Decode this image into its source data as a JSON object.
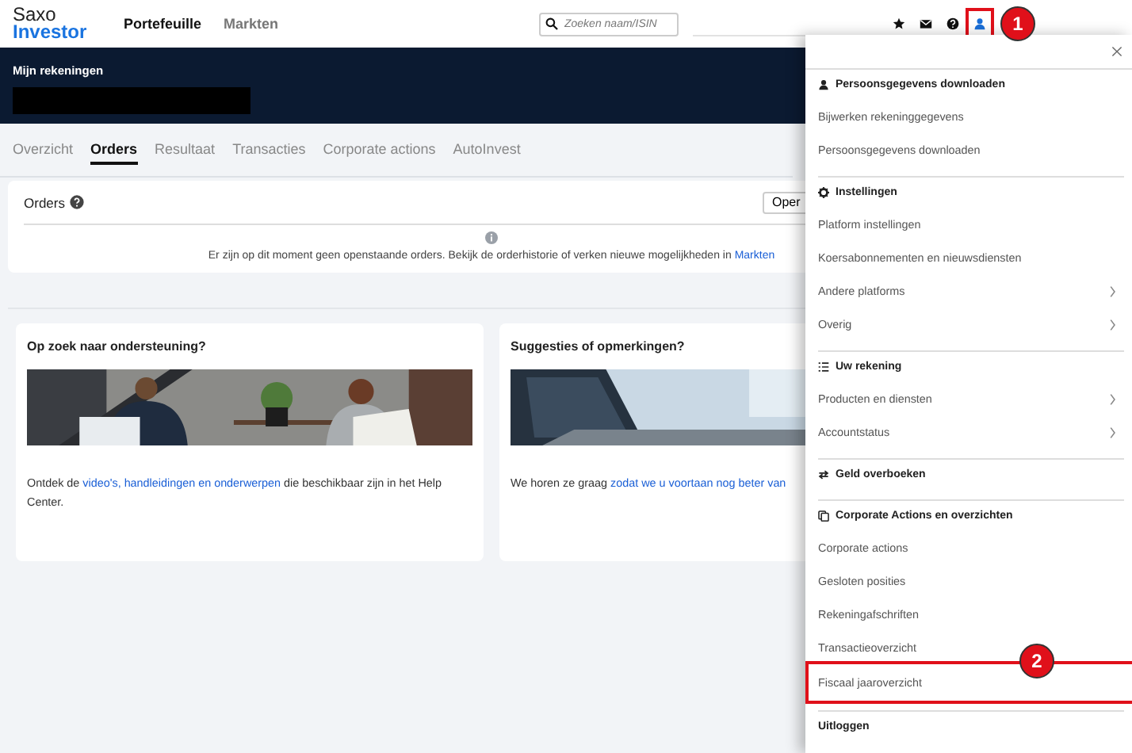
{
  "header": {
    "logo": {
      "line1": "Saxo",
      "line2": "Investor"
    },
    "nav": [
      {
        "label": "Portefeuille",
        "selected": true
      },
      {
        "label": "Markten",
        "selected": false
      }
    ],
    "search": {
      "placeholder": "Zoeken naam/ISIN"
    },
    "toolbar_icons": [
      {
        "kind": "star",
        "annotated": false
      },
      {
        "kind": "mail",
        "annotated": false
      },
      {
        "kind": "help",
        "annotated": false
      },
      {
        "kind": "user",
        "annotated": true,
        "badge": "1"
      }
    ]
  },
  "account_band": {
    "title": "Mijn rekeningen"
  },
  "tabs": [
    {
      "label": "Overzicht",
      "selected": false
    },
    {
      "label": "Orders",
      "selected": true
    },
    {
      "label": "Resultaat",
      "selected": false
    },
    {
      "label": "Transacties",
      "selected": false
    },
    {
      "label": "Corporate actions",
      "selected": false
    },
    {
      "label": "AutoInvest",
      "selected": false
    }
  ],
  "orders_card": {
    "title": "Orders",
    "button": "Oper",
    "message": [
      {
        "text": "Er zijn op dit moment geen openstaande orders. Bekijk de orderhistorie of verken nieuwe mogelijkheden in ",
        "link": false
      },
      {
        "text": "Markten",
        "link": true
      }
    ]
  },
  "cards": [
    {
      "title": "Op zoek naar ondersteuning?",
      "picture": {
        "kind": "picture"
      },
      "text": [
        {
          "text": "Ontdek de ",
          "link": false
        },
        {
          "text": "video's, handleidingen en onderwerpen",
          "link": true
        },
        {
          "text": " die beschikbaar zijn in het Help Center.",
          "link": false
        }
      ]
    },
    {
      "title": "Suggesties of opmerkingen?",
      "picture": {
        "kind": "picture"
      },
      "text": [
        {
          "text": "We horen ze graag ",
          "link": false
        },
        {
          "text": "zodat we u voortaan nog beter van",
          "link": true
        }
      ]
    }
  ],
  "menu": {
    "sections": [
      {
        "heading": "Persoonsgegevens downloaden",
        "kind": "person",
        "items": [
          {
            "label": "Bijwerken rekeninggegevens",
            "submenu": false,
            "annotated": false
          },
          {
            "label": "Persoonsgegevens downloaden",
            "submenu": false,
            "annotated": false
          }
        ]
      },
      {
        "heading": "Instellingen",
        "kind": "gear",
        "items": [
          {
            "label": "Platform instellingen",
            "submenu": false,
            "annotated": false
          },
          {
            "label": "Koersabonnementen en nieuwsdiensten",
            "submenu": false,
            "annotated": false
          },
          {
            "label": "Andere platforms",
            "submenu": true,
            "annotated": false
          },
          {
            "label": "Overig",
            "submenu": true,
            "annotated": false
          }
        ]
      },
      {
        "heading": "Uw rekening",
        "kind": "list",
        "items": [
          {
            "label": "Producten en diensten",
            "submenu": true,
            "annotated": false
          },
          {
            "label": "Accountstatus",
            "submenu": true,
            "annotated": false
          }
        ]
      },
      {
        "heading": "Geld overboeken",
        "kind": "transfer"
      },
      {
        "heading": "Corporate Actions en overzichten",
        "kind": "documents",
        "items": [
          {
            "label": "Corporate actions",
            "submenu": false,
            "annotated": false
          },
          {
            "label": "Gesloten posities",
            "submenu": false,
            "annotated": false
          },
          {
            "label": "Rekeningafschriften",
            "submenu": false,
            "annotated": false
          },
          {
            "label": "Transactieoverzicht",
            "submenu": false,
            "annotated": false
          },
          {
            "label": "Fiscaal jaaroverzicht",
            "submenu": false,
            "annotated": true,
            "badge": "2"
          }
        ]
      },
      {
        "heading": "Uitloggen"
      }
    ]
  }
}
